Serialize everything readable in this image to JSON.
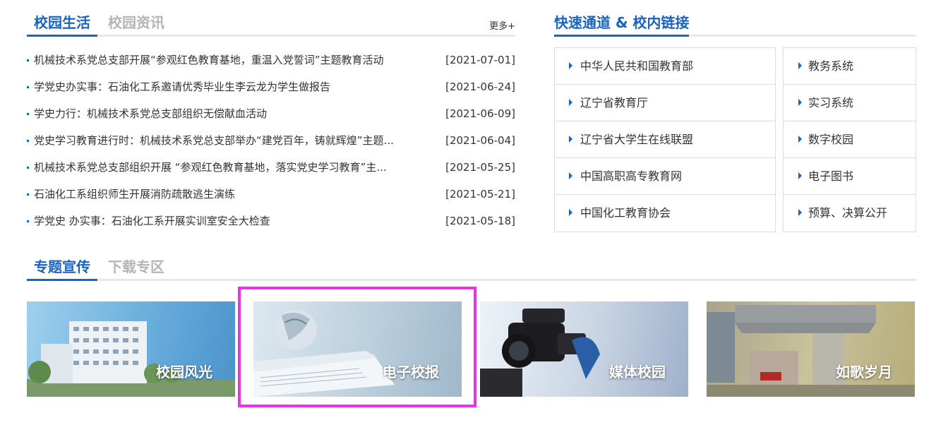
{
  "news": {
    "tabs": [
      "校园生活",
      "校园资讯"
    ],
    "more_label": "更多+",
    "items": [
      {
        "title": "机械技术系党总支部开展“参观红色教育基地，重温入党誓词”主题教育活动",
        "date": "[2021-07-01]"
      },
      {
        "title": "学党史办实事：石油化工系邀请优秀毕业生李云龙为学生做报告",
        "date": "[2021-06-24]"
      },
      {
        "title": "学史力行：机械技术系党总支部组织无偿献血活动",
        "date": "[2021-06-09]"
      },
      {
        "title": "党史学习教育进行时：机械技术系党总支部举办“建党百年，铸就辉煌”主题...",
        "date": "[2021-06-04]"
      },
      {
        "title": "机械技术系党总支部组织开展 “参观红色教育基地，落实党史学习教育”主...",
        "date": "[2021-05-25]"
      },
      {
        "title": "石油化工系组织师生开展消防疏散逃生演练",
        "date": "[2021-05-21]"
      },
      {
        "title": "学党史 办实事：石油化工系开展实训室安全大检查",
        "date": "[2021-05-18]"
      }
    ]
  },
  "links": {
    "heading": "快速通道 & 校内链接",
    "left": [
      "中华人民共和国教育部",
      "辽宁省教育厅",
      "辽宁省大学生在线联盟",
      "中国高职高专教育网",
      "中国化工教育协会"
    ],
    "right": [
      "教务系统",
      "实习系统",
      "数字校园",
      "电子图书",
      "预算、决算公开"
    ]
  },
  "featured": {
    "tabs": [
      "专题宣传",
      "下载专区"
    ],
    "cards": [
      {
        "caption": "校园风光"
      },
      {
        "caption": "电子校报"
      },
      {
        "caption": "媒体校园"
      },
      {
        "caption": "如歌岁月"
      }
    ]
  },
  "colors": {
    "accent": "#1863c4",
    "inactive_tab": "#b5b5b5",
    "highlight": "#e933e8"
  }
}
